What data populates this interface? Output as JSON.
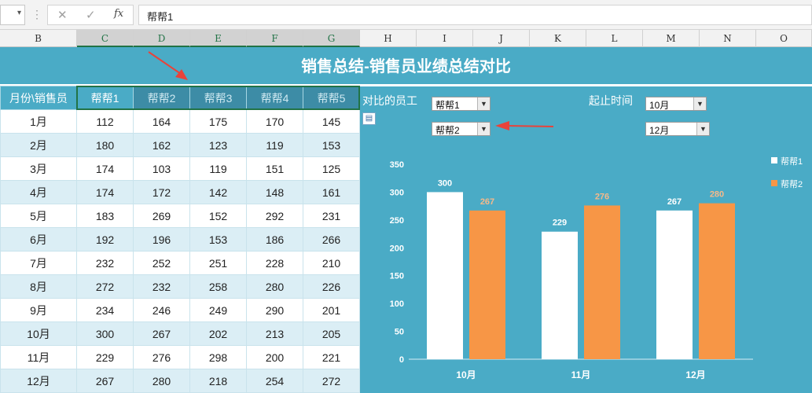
{
  "formula_bar": {
    "cancel_icon": "✕",
    "confirm_icon": "✓",
    "fx_label": "fx",
    "value": "帮帮1"
  },
  "columns": [
    "B",
    "C",
    "D",
    "E",
    "F",
    "G",
    "H",
    "I",
    "J",
    "K",
    "L",
    "M",
    "N",
    "O"
  ],
  "sheet": {
    "title": "销售总结-销售员业绩总结对比",
    "table": {
      "corner": "月份\\销售员",
      "headers": [
        "帮帮1",
        "帮帮2",
        "帮帮3",
        "帮帮4",
        "帮帮5"
      ],
      "rows": [
        {
          "month": "1月",
          "values": [
            112,
            164,
            175,
            170,
            145
          ]
        },
        {
          "month": "2月",
          "values": [
            180,
            162,
            123,
            119,
            153
          ]
        },
        {
          "month": "3月",
          "values": [
            174,
            103,
            119,
            151,
            125
          ]
        },
        {
          "month": "4月",
          "values": [
            174,
            172,
            142,
            148,
            161
          ]
        },
        {
          "month": "5月",
          "values": [
            183,
            269,
            152,
            292,
            231
          ]
        },
        {
          "month": "6月",
          "values": [
            192,
            196,
            153,
            186,
            266
          ]
        },
        {
          "month": "7月",
          "values": [
            232,
            252,
            251,
            228,
            210
          ]
        },
        {
          "month": "8月",
          "values": [
            272,
            232,
            258,
            280,
            226
          ]
        },
        {
          "month": "9月",
          "values": [
            234,
            246,
            249,
            290,
            201
          ]
        },
        {
          "month": "10月",
          "values": [
            300,
            267,
            202,
            213,
            205
          ]
        },
        {
          "month": "11月",
          "values": [
            229,
            276,
            298,
            200,
            221
          ]
        },
        {
          "month": "12月",
          "values": [
            267,
            280,
            218,
            254,
            272
          ]
        }
      ]
    },
    "controls": {
      "compare_label": "对比的员工",
      "employee1": "帮帮1",
      "employee2": "帮帮2",
      "period_label": "起止时间",
      "start": "10月",
      "end": "12月"
    }
  },
  "colors": {
    "background": "#4aabc6",
    "series1": "#ffffff",
    "series2": "#f79646",
    "arrow": "#e8433b"
  },
  "chart_data": {
    "type": "bar",
    "categories": [
      "10月",
      "11月",
      "12月"
    ],
    "series": [
      {
        "name": "帮帮1",
        "values": [
          300,
          229,
          267
        ],
        "color": "#ffffff"
      },
      {
        "name": "帮帮2",
        "values": [
          267,
          276,
          280
        ],
        "color": "#f79646"
      }
    ],
    "ylim": [
      0,
      350
    ],
    "yticks": [
      0,
      50,
      100,
      150,
      200,
      250,
      300,
      350
    ],
    "grid": false,
    "legend": "top-right"
  }
}
